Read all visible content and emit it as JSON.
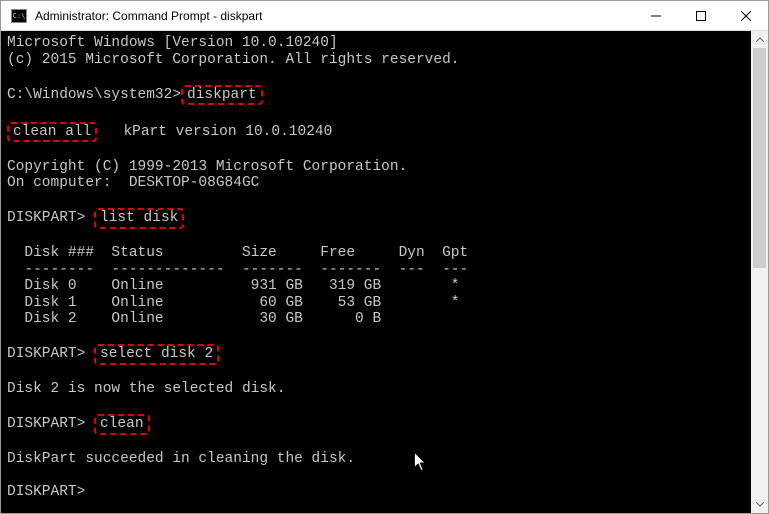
{
  "window": {
    "title": "Administrator: Command Prompt - diskpart",
    "icon_label": "C:\\"
  },
  "terminal": {
    "line1": "Microsoft Windows [Version 10.0.10240]",
    "line2": "(c) 2015 Microsoft Corporation. All rights reserved.",
    "prompt1_prefix": "C:\\Windows\\system32>",
    "cmd_diskpart": "diskpart",
    "cmd_cleanall": "clean all",
    "version_suffix": "kPart version 10.0.10240",
    "copyright": "Copyright (C) 1999-2013 Microsoft Corporation.",
    "computer": "On computer:  DESKTOP-08G84GC",
    "dp_prompt": "DISKPART>",
    "cmd_listdisk": "list disk",
    "table_header": "  Disk ###  Status         Size     Free     Dyn  Gpt",
    "table_divider": "  --------  -------------  -------  -------  ---  ---",
    "row0": "  Disk 0    Online          931 GB   319 GB        *",
    "row1": "  Disk 1    Online           60 GB    53 GB        *",
    "row2": "  Disk 2    Online           30 GB      0 B",
    "cmd_selectdisk": "select disk 2",
    "selected_msg": "Disk 2 is now the selected disk.",
    "cmd_clean": "clean",
    "succeeded_msg": "DiskPart succeeded in cleaning the disk.",
    "pad1": " ",
    "pad3": "   "
  },
  "chart_data": {
    "type": "table",
    "title": "DISKPART list disk",
    "columns": [
      "Disk ###",
      "Status",
      "Size",
      "Free",
      "Dyn",
      "Gpt"
    ],
    "rows": [
      {
        "Disk ###": "Disk 0",
        "Status": "Online",
        "Size": "931 GB",
        "Free": "319 GB",
        "Dyn": "",
        "Gpt": "*"
      },
      {
        "Disk ###": "Disk 1",
        "Status": "Online",
        "Size": "60 GB",
        "Free": "53 GB",
        "Dyn": "",
        "Gpt": "*"
      },
      {
        "Disk ###": "Disk 2",
        "Status": "Online",
        "Size": "30 GB",
        "Free": "0 B",
        "Dyn": "",
        "Gpt": ""
      }
    ]
  }
}
